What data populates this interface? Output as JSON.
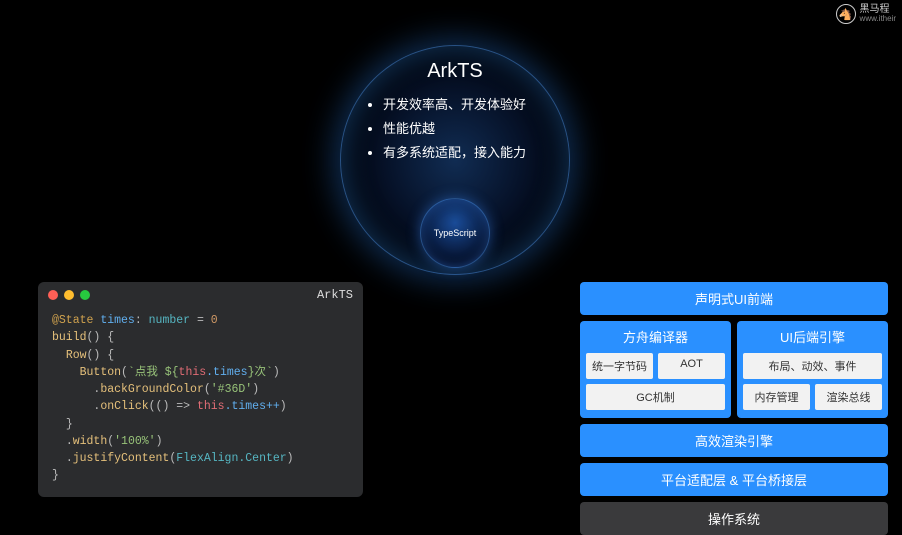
{
  "brand": {
    "name": "黑马程",
    "sub": "www.itheir"
  },
  "bigCircle": {
    "title": "ArkTS",
    "bullets": [
      "开发效率高、开发体验好",
      "性能优越",
      "有多系统适配，接入能力"
    ],
    "inner": "TypeScript"
  },
  "codeWindow": {
    "title": "ArkTS",
    "code": {
      "line1_decorator": "@State",
      "line1_var": " times",
      "line1_type": "number",
      "line1_eq": " = ",
      "line1_val": "0",
      "build": "build",
      "row": "Row",
      "button": "Button",
      "btn_str_pre": "`点我 ${",
      "btn_this": "this",
      "btn_prop": ".times",
      "btn_str_post": "}次`",
      "bgColor": "backGroundColor",
      "bgArg": "'#36D'",
      "onClick": "onClick",
      "clickBody_this": "this",
      "clickBody_prop": ".times++",
      "width": "width",
      "widthArg": "'100%'",
      "justify": "justifyContent",
      "justifyArg": "FlexAlign.Center"
    }
  },
  "arch": {
    "header": "声明式UI前端",
    "left": {
      "title": "方舟编译器",
      "row1": [
        "统一字节码",
        "AOT"
      ],
      "row2": [
        "GC机制"
      ]
    },
    "right": {
      "title": "UI后端引擎",
      "row1": [
        "布局、动效、事件"
      ],
      "row2": [
        "内存管理",
        "渲染总线"
      ]
    },
    "render": "高效渲染引擎",
    "platform": "平台适配层 & 平台桥接层",
    "os": "操作系统"
  }
}
